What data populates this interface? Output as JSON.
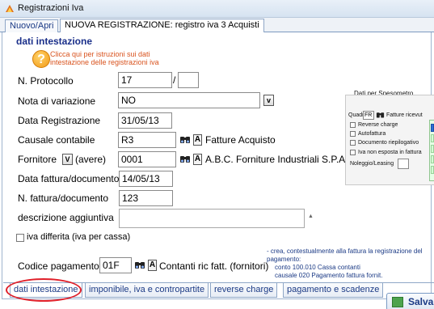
{
  "window": {
    "title": "Registrazioni Iva"
  },
  "tabs": [
    {
      "label": "Nuovo/Apri"
    },
    {
      "label": "NUOVA REGISTRAZIONE: registro iva 3 Acquisti"
    }
  ],
  "section": {
    "title": "dati intestazione",
    "help_text": "Clicca qui per istruzioni sui dati intestazione delle registrazioni iva"
  },
  "form": {
    "protocollo_label": "N. Protocollo",
    "protocollo_value": "17",
    "protocollo_separator": "/",
    "protocollo_suffix": "",
    "nota_label": "Nota di variazione",
    "nota_value": "NO",
    "nota_dropdown": "v",
    "data_reg_label": "Data Registrazione",
    "data_reg_value": "31/05/13",
    "causale_label": "Causale contabile",
    "causale_value": "R3",
    "causale_desc": "Fatture Acquisto",
    "fornitore_label": "Fornitore",
    "fornitore_dropdown": "V",
    "fornitore_role": "(avere)",
    "fornitore_value": "0001",
    "fornitore_desc": "A.B.C. Forniture Industriali S.P.A",
    "data_fattura_label": "Data fattura/documento",
    "data_fattura_value": "14/05/13",
    "n_fattura_label": "N. fattura/documento",
    "n_fattura_value": "123",
    "descrizione_label": "descrizione aggiuntiva",
    "descrizione_value": "",
    "iva_differita_label": "iva differita (iva per cassa)",
    "codice_pagamento_label": "Codice pagamento",
    "codice_pagamento_value": "01F",
    "codice_pagamento_desc": "Contanti ric fatt. (fornitori)",
    "a_button": "A"
  },
  "spesometro": {
    "title": "Dati per Spesometro",
    "quadro_label": "Quadro",
    "quadro_value": "FR",
    "fatture_label": "Fatture ricevut",
    "reverse_charge": "Reverse charge",
    "autofattura": "Autofattura",
    "documento_riepilogativo": "Documento riepilogativo",
    "iva_non_esposta": "Iva non esposta in fattura",
    "noleggio": "Noleggio/Leasing"
  },
  "note": {
    "line1": "- crea, contestualmente alla fattura la registrazione del pagamento:",
    "line2": "conto 100.010 Cassa contanti",
    "line3": "causale 020 Pagamento fattura fornit."
  },
  "bottom_tabs": [
    {
      "label": "dati intestazione"
    },
    {
      "label": "imponibile, iva e contropartite"
    },
    {
      "label": "reverse charge"
    },
    {
      "label": "pagamento e scadenze"
    }
  ],
  "save_label": "Salva",
  "colors": {
    "accent": "#1a2f8a",
    "help": "#d9531e",
    "highlight": "#e0202a"
  }
}
